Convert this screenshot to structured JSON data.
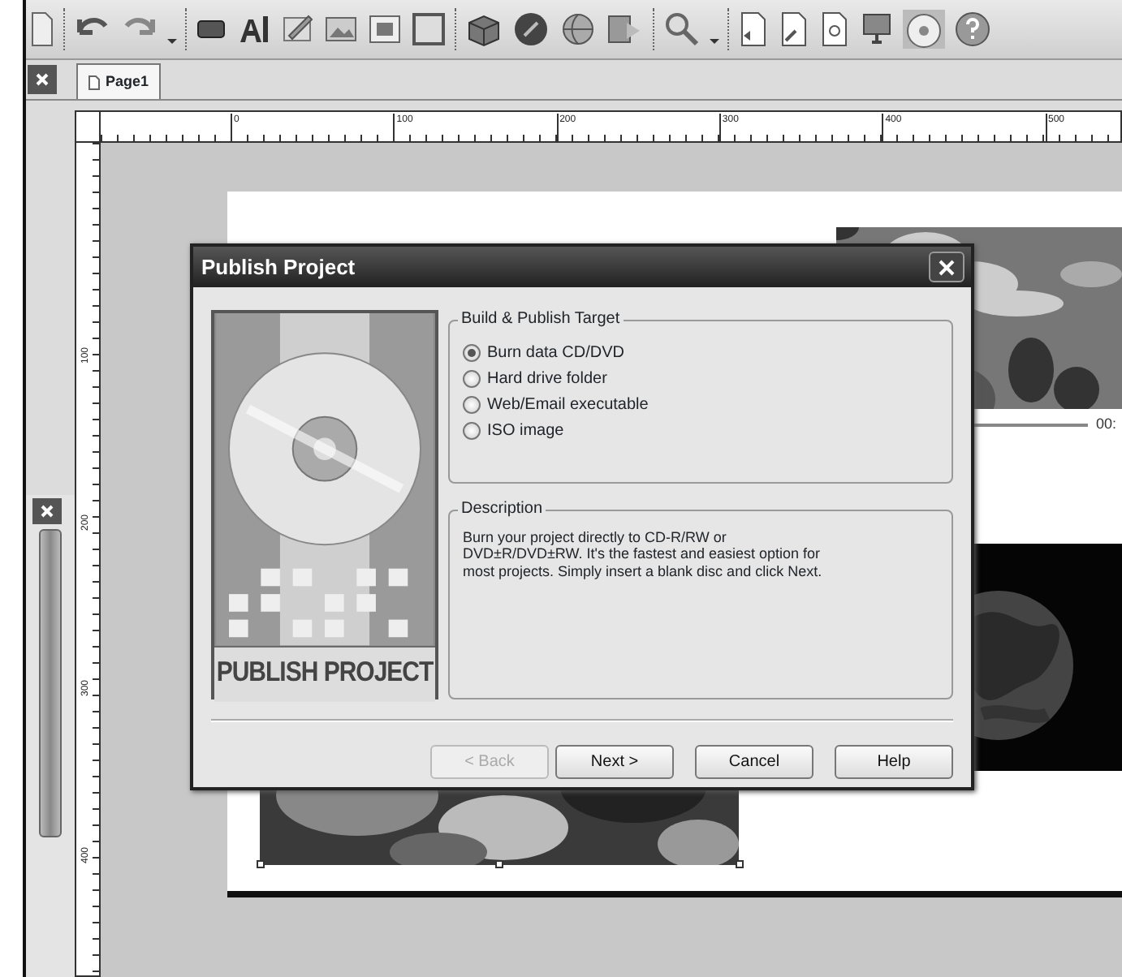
{
  "tabs": [
    {
      "label": "Page1",
      "selected": true
    }
  ],
  "ruler": {
    "top_labels": [
      "0",
      "100",
      "200",
      "300",
      "400",
      "500"
    ],
    "side_labels": [
      "100",
      "200",
      "300",
      "400"
    ]
  },
  "media": {
    "timecode": "00:"
  },
  "dialog": {
    "title": "Publish Project",
    "banner": "PUBLISH PROJECT",
    "target_group": {
      "title": "Build & Publish Target",
      "options": [
        {
          "label": "Burn data CD/DVD",
          "selected": true
        },
        {
          "label": "Hard drive folder",
          "selected": false
        },
        {
          "label": "Web/Email executable",
          "selected": false
        },
        {
          "label": "ISO image",
          "selected": false
        }
      ]
    },
    "description": {
      "title": "Description",
      "text": "Burn your project directly to CD-R/RW or\nDVD±R/DVD±RW. It's the fastest and easiest option for\nmost projects. Simply insert a blank disc and click Next."
    },
    "buttons": [
      {
        "label": "< Back",
        "disabled": true
      },
      {
        "label": "Next >",
        "disabled": false
      },
      {
        "label": "Cancel",
        "disabled": false
      },
      {
        "label": "Help",
        "disabled": false
      }
    ]
  }
}
